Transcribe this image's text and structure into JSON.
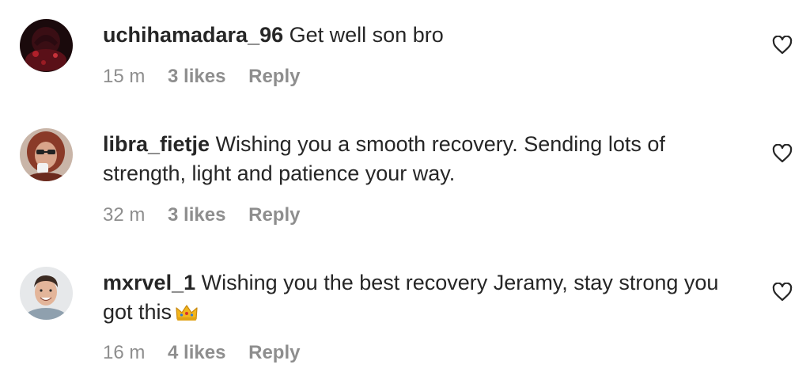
{
  "comments": [
    {
      "username": "uchihamadara_96",
      "text": "Get well son bro",
      "time": "15 m",
      "likes": "3 likes",
      "reply": "Reply",
      "avatar_icon": "dark-red-avatar"
    },
    {
      "username": "libra_fietje",
      "text": "Wishing you a smooth recovery. Sending lots of strength, light and patience your way.",
      "time": "32 m",
      "likes": "3 likes",
      "reply": "Reply",
      "avatar_icon": "woman-with-cup-avatar"
    },
    {
      "username": "mxrvel_1",
      "text": "Wishing you the best recovery Jeramy, stay strong you got this",
      "time": "16 m",
      "likes": "4 likes",
      "reply": "Reply",
      "avatar_icon": "smiling-man-avatar",
      "emoji": "crown-icon"
    }
  ],
  "colors": {
    "text": "#262626",
    "meta": "#8e8e8e",
    "background": "#ffffff"
  }
}
